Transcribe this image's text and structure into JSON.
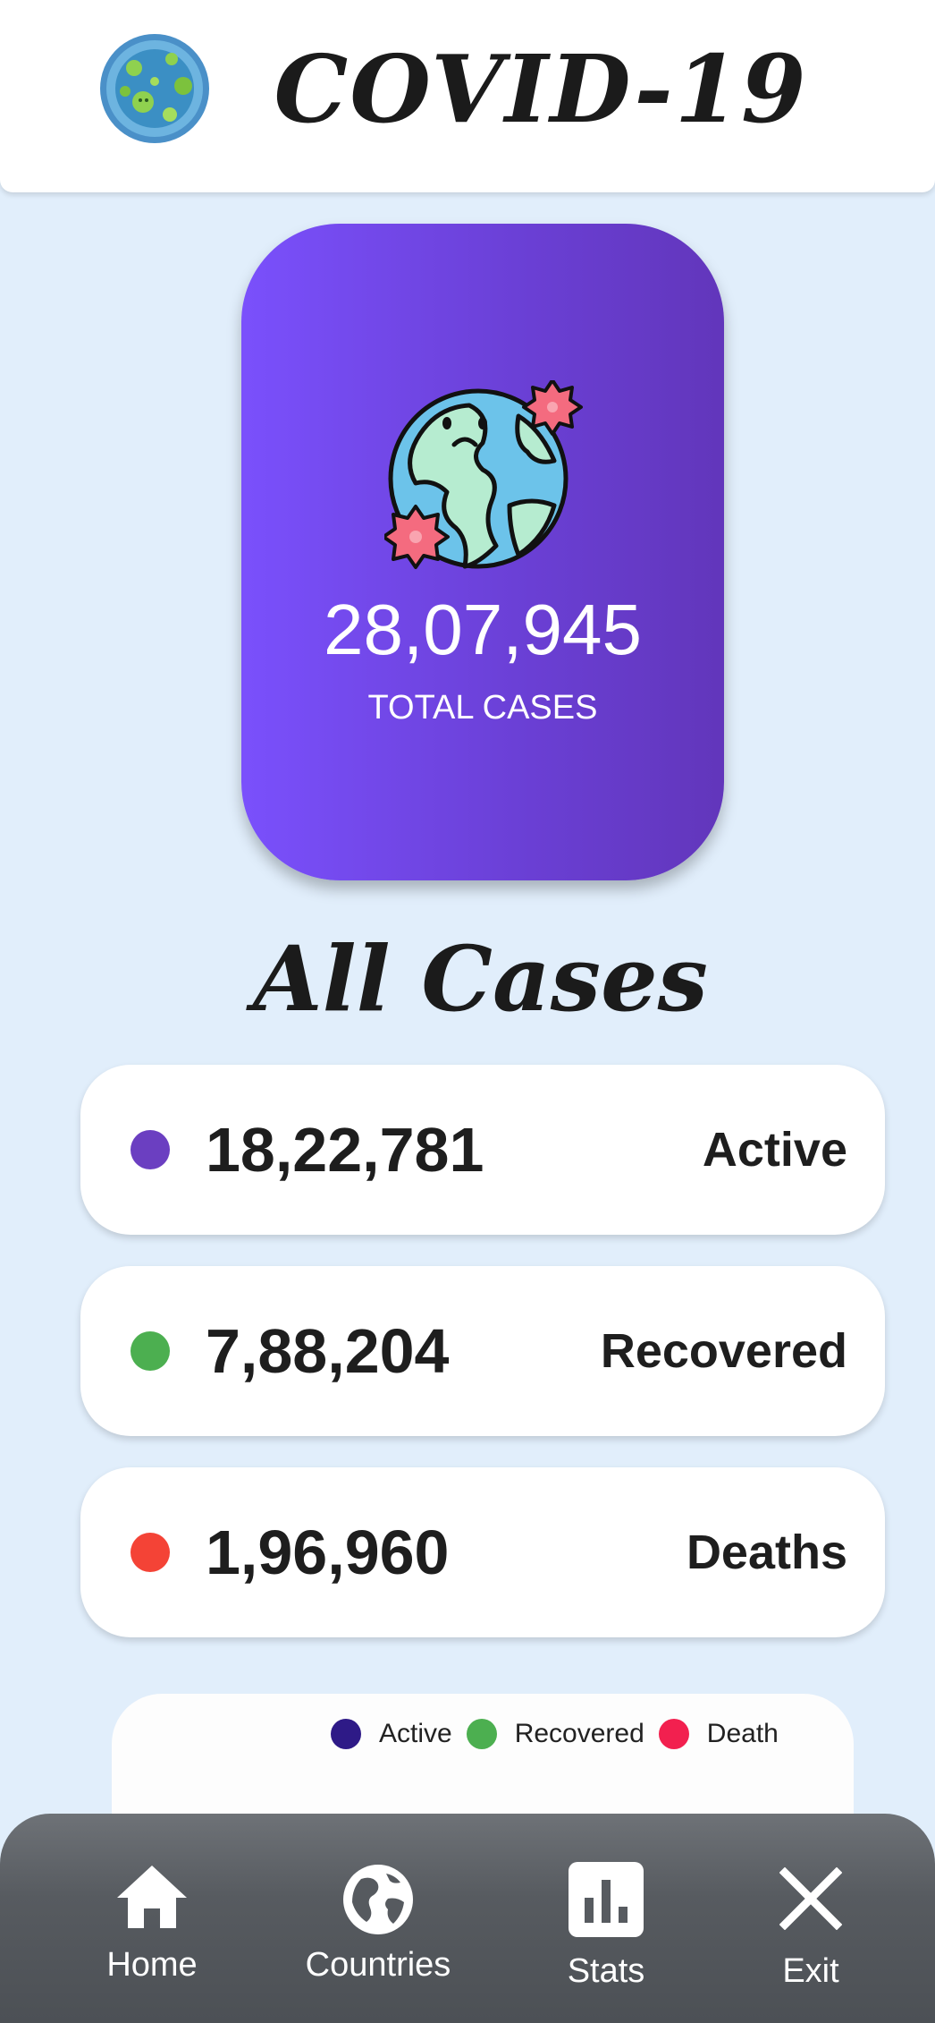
{
  "header": {
    "title": "COVID-19",
    "logo_icon": "virus-globe-icon"
  },
  "total": {
    "icon": "sad-globe-virus-icon",
    "value": "28,07,945",
    "label": "TOTAL CASES"
  },
  "section_title": "All Cases",
  "cases": [
    {
      "value": "18,22,781",
      "label": "Active",
      "color": "#6b3fc1"
    },
    {
      "value": "7,88,204",
      "label": "Recovered",
      "color": "#4caf50"
    },
    {
      "value": "1,96,960",
      "label": "Deaths",
      "color": "#f44336"
    }
  ],
  "chart_legend": [
    {
      "label": "Active",
      "color": "#2e1a87"
    },
    {
      "label": "Recovered",
      "color": "#4caf50"
    },
    {
      "label": "Death",
      "color": "#f2204f"
    }
  ],
  "nav": {
    "items": [
      {
        "label": "Home",
        "icon": "home-icon"
      },
      {
        "label": "Countries",
        "icon": "globe-icon"
      },
      {
        "label": "Stats",
        "icon": "bar-chart-icon"
      },
      {
        "label": "Exit",
        "icon": "close-icon"
      }
    ]
  },
  "colors": {
    "background": "#e1eefb",
    "card_gradient_start": "#7a50fc",
    "card_gradient_end": "#6236bb",
    "nav_background": "#575b60"
  }
}
